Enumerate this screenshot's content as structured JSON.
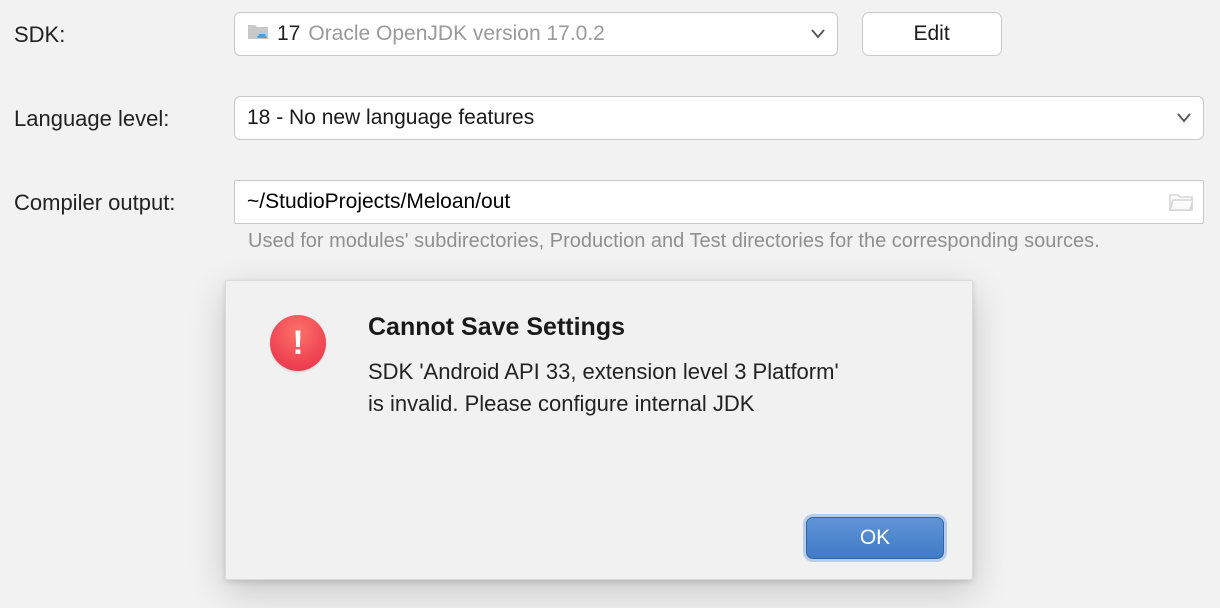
{
  "labels": {
    "sdk": "SDK:",
    "language_level": "Language level:",
    "compiler_output": "Compiler output:"
  },
  "sdk": {
    "name": "17",
    "version": "Oracle OpenJDK version 17.0.2",
    "edit_label": "Edit"
  },
  "language_level": {
    "value": "18 - No new language features"
  },
  "compiler_output": {
    "value": "~/StudioProjects/Meloan/out",
    "help": "Used for modules' subdirectories, Production and Test directories for the corresponding sources."
  },
  "dialog": {
    "title": "Cannot Save Settings",
    "message": "SDK 'Android API 33, extension level 3 Platform' is invalid. Please configure internal JDK",
    "ok_label": "OK"
  }
}
